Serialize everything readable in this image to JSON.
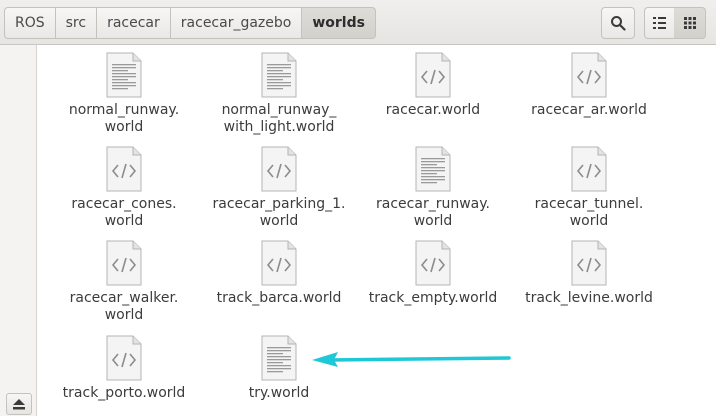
{
  "breadcrumb": [
    "ROS",
    "src",
    "racecar",
    "racecar_gazebo",
    "worlds"
  ],
  "toolbar": {
    "search_icon": "search-icon",
    "list_view_icon": "list-view-icon",
    "grid_view_icon": "grid-view-icon"
  },
  "files": [
    {
      "name": "normal_runway.\nworld",
      "icon": "text-file-icon"
    },
    {
      "name": "normal_runway_\nwith_light.world",
      "icon": "text-file-icon"
    },
    {
      "name": "racecar.world",
      "icon": "code-file-icon"
    },
    {
      "name": "racecar_ar.world",
      "icon": "code-file-icon"
    },
    {
      "name": "racecar_cones.\nworld",
      "icon": "code-file-icon"
    },
    {
      "name": "racecar_parking_1.\nworld",
      "icon": "code-file-icon"
    },
    {
      "name": "racecar_runway.\nworld",
      "icon": "text-file-icon"
    },
    {
      "name": "racecar_tunnel.\nworld",
      "icon": "code-file-icon"
    },
    {
      "name": "racecar_walker.\nworld",
      "icon": "code-file-icon"
    },
    {
      "name": "track_barca.world",
      "icon": "code-file-icon"
    },
    {
      "name": "track_empty.world",
      "icon": "code-file-icon"
    },
    {
      "name": "track_levine.world",
      "icon": "code-file-icon"
    },
    {
      "name": "track_porto.world",
      "icon": "code-file-icon"
    },
    {
      "name": "try.world",
      "icon": "text-file-icon"
    }
  ],
  "annotation": {
    "color": "#1ec8d6"
  }
}
